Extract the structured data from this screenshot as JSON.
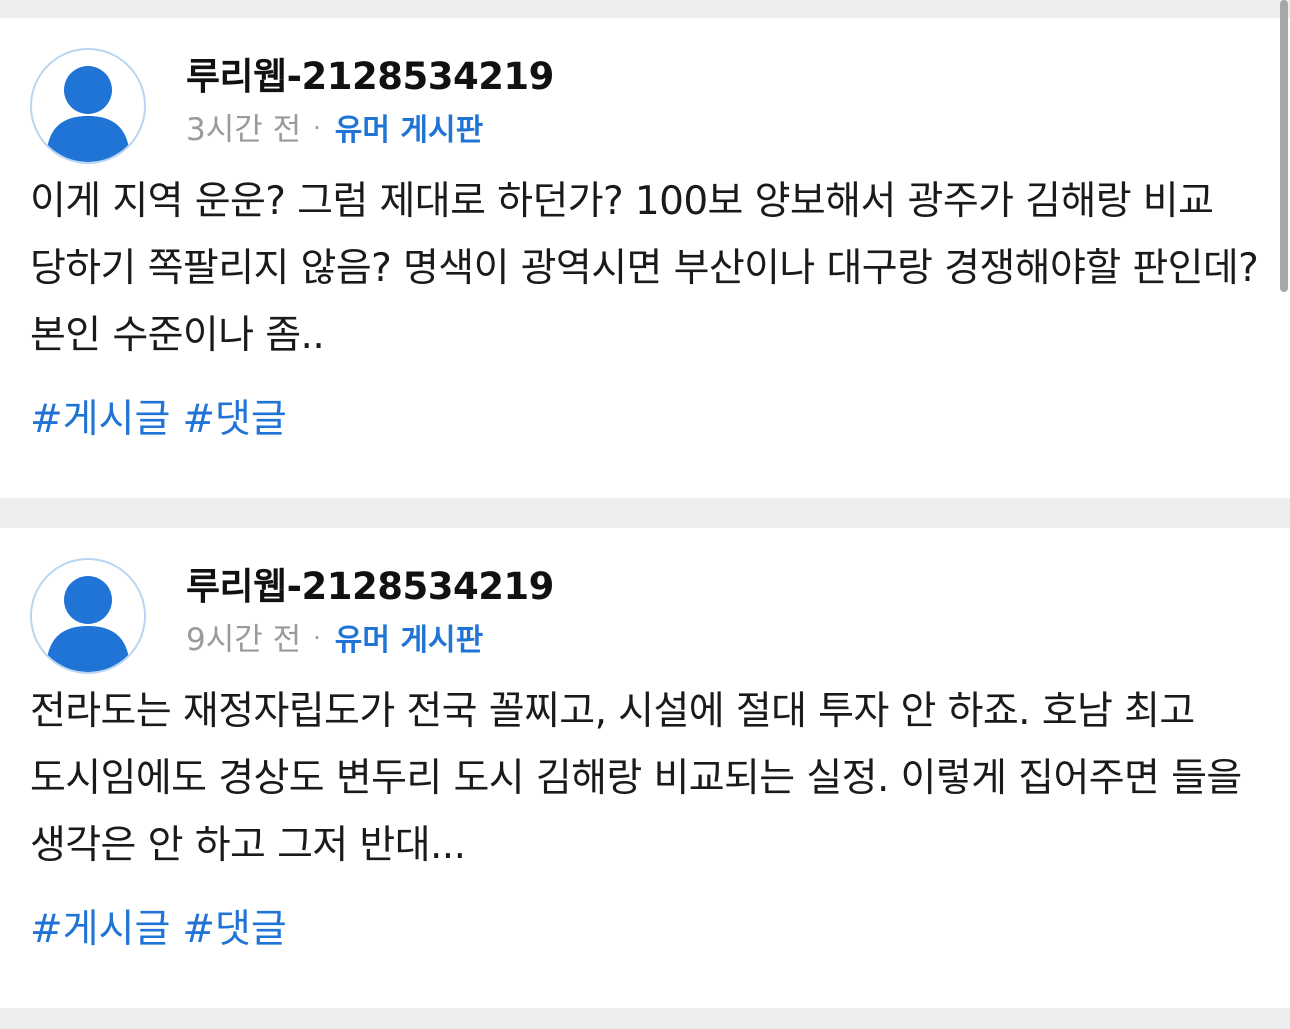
{
  "posts": [
    {
      "username": "루리웹-2128534219",
      "time": "3시간 전",
      "separator": "·",
      "board": "유머 게시판",
      "body": "이게 지역 운운? 그럼 제대로 하던가? 100보 양보해서 광주가 김해랑 비교 당하기 쪽팔리지 않음? 명색이 광역시면 부산이나 대구랑 경쟁해야할 판인데? 본인 수준이나 좀..",
      "tags": [
        "#게시글",
        "#댓글"
      ]
    },
    {
      "username": "루리웹-2128534219",
      "time": "9시간 전",
      "separator": "·",
      "board": "유머 게시판",
      "body": "전라도는 재정자립도가 전국 꼴찌고, 시설에 절대 투자 안 하죠. 호남 최고 도시임에도 경상도 변두리 도시 김해랑 비교되는 실정. 이렇게 집어주면 들을 생각은 안 하고 그저 반대...",
      "tags": [
        "#게시글",
        "#댓글"
      ]
    }
  ],
  "colors": {
    "accent": "#1f74d6",
    "avatar_fill": "#1f74d6",
    "avatar_border": "#b7d6f3",
    "background": "#eeeeee",
    "meta_text": "#9a9a9a"
  },
  "icons": {
    "avatar": "default-user-avatar-icon"
  }
}
